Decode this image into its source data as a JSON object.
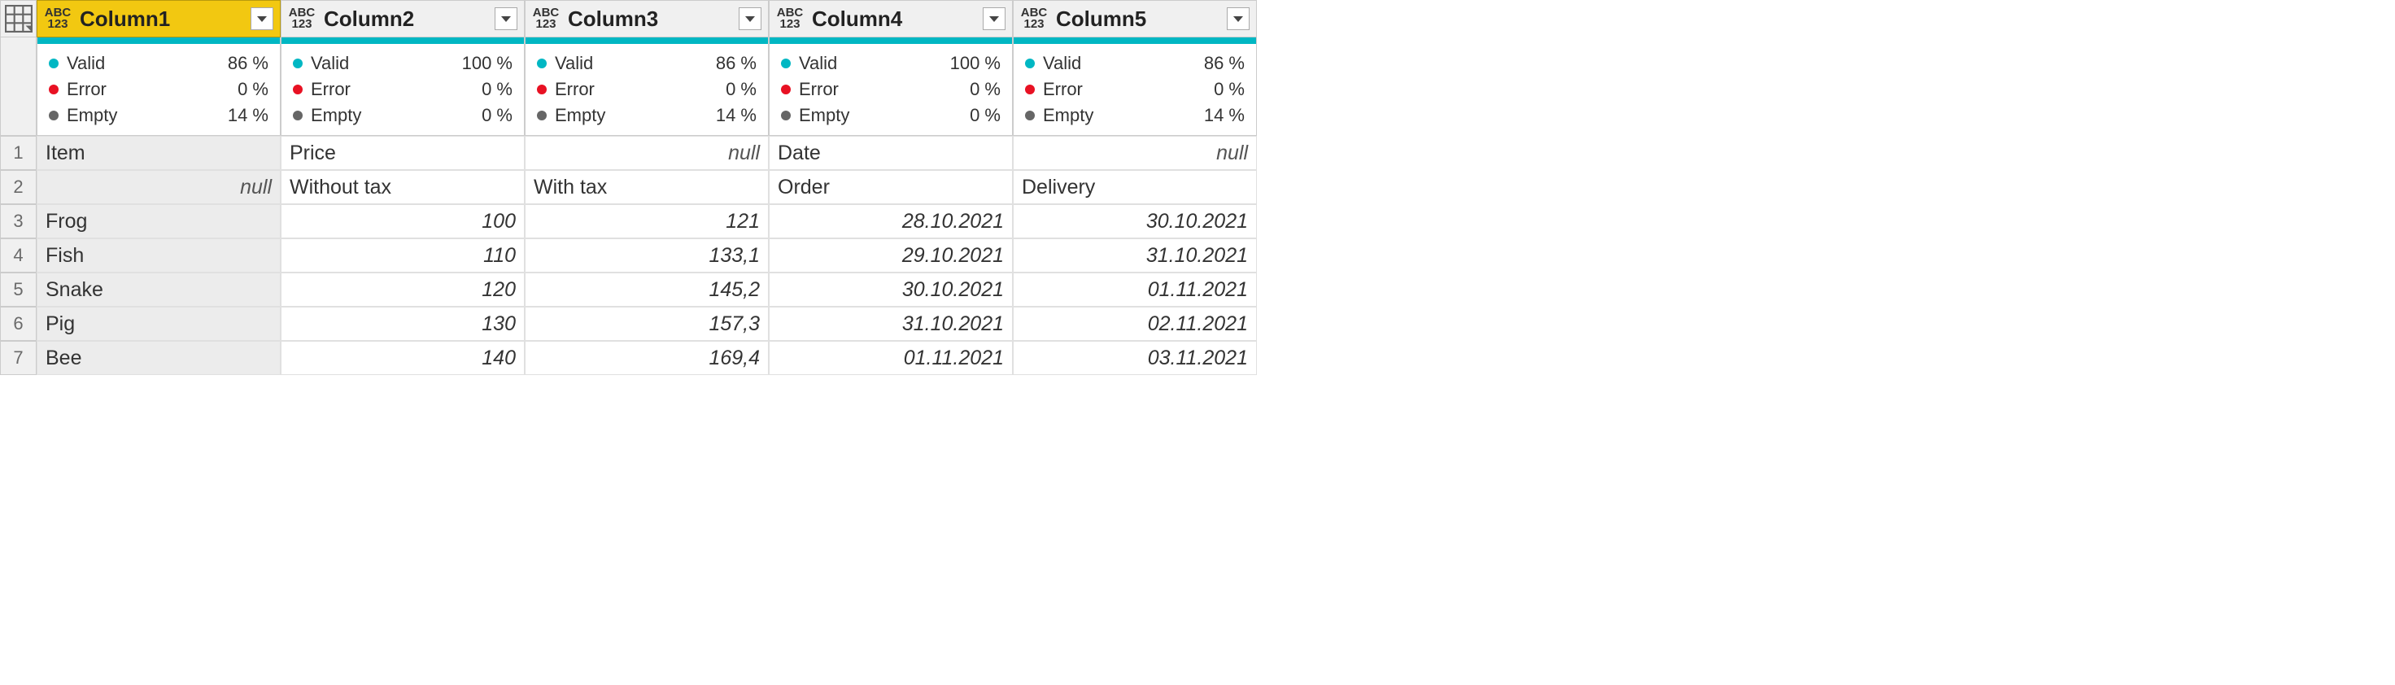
{
  "typeIcon": {
    "top": "ABC",
    "bottom": "123"
  },
  "labels": {
    "valid": "Valid",
    "error": "Error",
    "empty": "Empty"
  },
  "columns": [
    {
      "name": "Column1",
      "selected": true,
      "stats": {
        "valid": "86 %",
        "error": "0 %",
        "empty": "14 %"
      }
    },
    {
      "name": "Column2",
      "selected": false,
      "stats": {
        "valid": "100 %",
        "error": "0 %",
        "empty": "0 %"
      }
    },
    {
      "name": "Column3",
      "selected": false,
      "stats": {
        "valid": "86 %",
        "error": "0 %",
        "empty": "14 %"
      }
    },
    {
      "name": "Column4",
      "selected": false,
      "stats": {
        "valid": "100 %",
        "error": "0 %",
        "empty": "0 %"
      }
    },
    {
      "name": "Column5",
      "selected": false,
      "stats": {
        "valid": "86 %",
        "error": "0 %",
        "empty": "14 %"
      }
    }
  ],
  "rows": [
    {
      "n": "1",
      "cells": [
        {
          "text": "Item",
          "align": "left",
          "first": true
        },
        {
          "text": "Price",
          "align": "left"
        },
        {
          "text": "null",
          "null": true
        },
        {
          "text": "Date",
          "align": "left"
        },
        {
          "text": "null",
          "null": true
        }
      ]
    },
    {
      "n": "2",
      "cells": [
        {
          "text": "null",
          "null": true,
          "first": true
        },
        {
          "text": "Without tax",
          "align": "left"
        },
        {
          "text": "With tax",
          "align": "left"
        },
        {
          "text": "Order",
          "align": "left"
        },
        {
          "text": "Delivery",
          "align": "left"
        }
      ]
    },
    {
      "n": "3",
      "cells": [
        {
          "text": "Frog",
          "align": "left",
          "first": true
        },
        {
          "text": "100",
          "align": "right",
          "italic": true
        },
        {
          "text": "121",
          "align": "right",
          "italic": true
        },
        {
          "text": "28.10.2021",
          "align": "right",
          "italic": true
        },
        {
          "text": "30.10.2021",
          "align": "right",
          "italic": true
        }
      ]
    },
    {
      "n": "4",
      "cells": [
        {
          "text": "Fish",
          "align": "left",
          "first": true
        },
        {
          "text": "110",
          "align": "right",
          "italic": true
        },
        {
          "text": "133,1",
          "align": "right",
          "italic": true
        },
        {
          "text": "29.10.2021",
          "align": "right",
          "italic": true
        },
        {
          "text": "31.10.2021",
          "align": "right",
          "italic": true
        }
      ]
    },
    {
      "n": "5",
      "cells": [
        {
          "text": "Snake",
          "align": "left",
          "first": true
        },
        {
          "text": "120",
          "align": "right",
          "italic": true
        },
        {
          "text": "145,2",
          "align": "right",
          "italic": true
        },
        {
          "text": "30.10.2021",
          "align": "right",
          "italic": true
        },
        {
          "text": "01.11.2021",
          "align": "right",
          "italic": true
        }
      ]
    },
    {
      "n": "6",
      "cells": [
        {
          "text": "Pig",
          "align": "left",
          "first": true
        },
        {
          "text": "130",
          "align": "right",
          "italic": true
        },
        {
          "text": "157,3",
          "align": "right",
          "italic": true
        },
        {
          "text": "31.10.2021",
          "align": "right",
          "italic": true
        },
        {
          "text": "02.11.2021",
          "align": "right",
          "italic": true
        }
      ]
    },
    {
      "n": "7",
      "cells": [
        {
          "text": "Bee",
          "align": "left",
          "first": true
        },
        {
          "text": "140",
          "align": "right",
          "italic": true
        },
        {
          "text": "169,4",
          "align": "right",
          "italic": true
        },
        {
          "text": "01.11.2021",
          "align": "right",
          "italic": true
        },
        {
          "text": "03.11.2021",
          "align": "right",
          "italic": true
        }
      ]
    }
  ]
}
